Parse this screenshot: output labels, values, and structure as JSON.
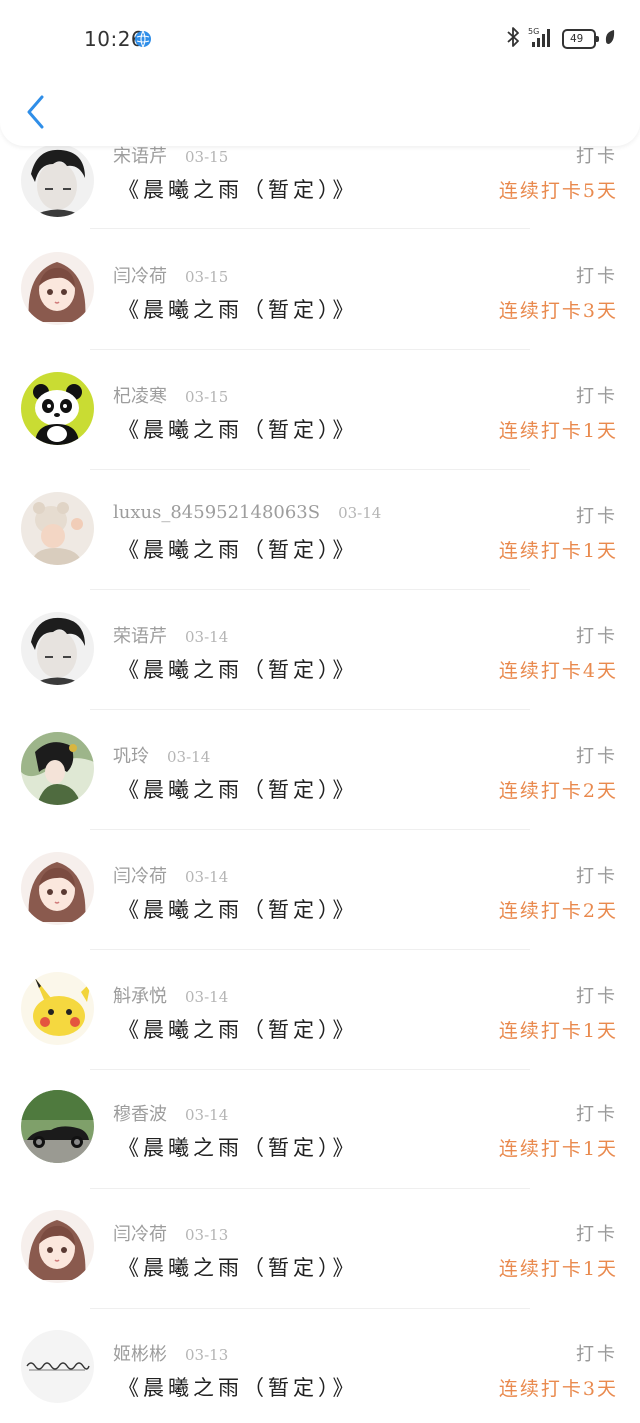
{
  "status_bar": {
    "time": "10:26",
    "network": "5G",
    "battery": "49"
  },
  "nav": {
    "back_icon": "chevron-left-icon"
  },
  "colors": {
    "accent_blue": "#2f8ee8",
    "streak_orange": "#e98a4e",
    "meta_gray": "#a5a5a5"
  },
  "checkins": [
    {
      "username": "宋语芹",
      "date": "03-15",
      "book": "《晨曦之雨（暂定）》",
      "label": "打卡",
      "streak": "连续打卡5天",
      "avatar": "boy-bw"
    },
    {
      "username": "闫冷荷",
      "date": "03-15",
      "book": "《晨曦之雨（暂定）》",
      "label": "打卡",
      "streak": "连续打卡3天",
      "avatar": "girl-anime"
    },
    {
      "username": "杞凌寒",
      "date": "03-15",
      "book": "《晨曦之雨（暂定）》",
      "label": "打卡",
      "streak": "连续打卡1天",
      "avatar": "panda"
    },
    {
      "username": "luxus_845952148063S",
      "date": "03-14",
      "book": "《晨曦之雨（暂定）》",
      "label": "打卡",
      "streak": "连续打卡1天",
      "avatar": "baby-bear"
    },
    {
      "username": "荣语芹",
      "date": "03-14",
      "book": "《晨曦之雨（暂定）》",
      "label": "打卡",
      "streak": "连续打卡4天",
      "avatar": "boy-bw"
    },
    {
      "username": "巩玲",
      "date": "03-14",
      "book": "《晨曦之雨（暂定）》",
      "label": "打卡",
      "streak": "连续打卡2天",
      "avatar": "ancient-lady"
    },
    {
      "username": "闫冷荷",
      "date": "03-14",
      "book": "《晨曦之雨（暂定）》",
      "label": "打卡",
      "streak": "连续打卡2天",
      "avatar": "girl-anime"
    },
    {
      "username": "斛承悦",
      "date": "03-14",
      "book": "《晨曦之雨（暂定）》",
      "label": "打卡",
      "streak": "连续打卡1天",
      "avatar": "pikachu"
    },
    {
      "username": "穆香波",
      "date": "03-14",
      "book": "《晨曦之雨（暂定）》",
      "label": "打卡",
      "streak": "连续打卡1天",
      "avatar": "car"
    },
    {
      "username": "闫冷荷",
      "date": "03-13",
      "book": "《晨曦之雨（暂定）》",
      "label": "打卡",
      "streak": "连续打卡1天",
      "avatar": "girl-anime"
    },
    {
      "username": "姬彬彬",
      "date": "03-13",
      "book": "《晨曦之雨（暂定）》",
      "label": "打卡",
      "streak": "连续打卡3天",
      "avatar": "calligraphy"
    }
  ]
}
